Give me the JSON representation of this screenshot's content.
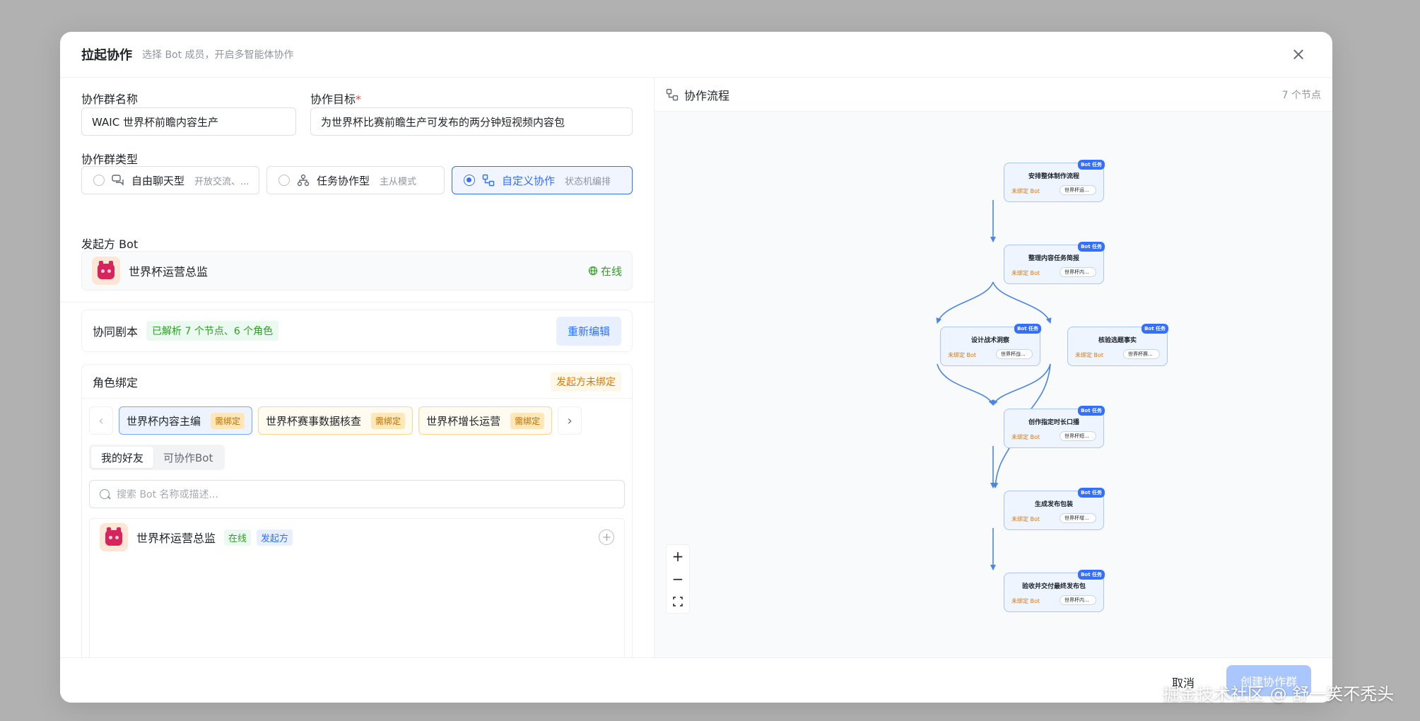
{
  "header": {
    "title": "拉起协作",
    "subtitle": "选择 Bot 成员，开启多智能体协作"
  },
  "form": {
    "group_name_label": "协作群名称",
    "group_name_value": "WAIC 世界杯前瞻内容生产",
    "goal_label": "协作目标",
    "goal_required_mark": "*",
    "goal_value": "为世界杯比赛前瞻生产可发布的两分钟短视频内容包",
    "type_label": "协作群类型",
    "types": [
      {
        "label": "自由聊天型",
        "sub": "开放交流、...",
        "icon": "chat-icon",
        "selected": false
      },
      {
        "label": "任务协作型",
        "sub": "主从模式",
        "icon": "hierarchy-icon",
        "selected": false
      },
      {
        "label": "自定义协作",
        "sub": "状态机编排",
        "icon": "flow-icon",
        "selected": true
      }
    ],
    "initiator_label": "发起方 Bot",
    "initiator_name": "世界杯运营总监",
    "initiator_status": "在线"
  },
  "script": {
    "label": "协同剧本",
    "parsed_tag": "已解析 7 个节点、6 个角色",
    "reedit_label": "重新编辑"
  },
  "roles": {
    "label": "角色绑定",
    "warning_tag": "发起方未绑定",
    "chips": [
      {
        "name": "世界杯内容主编",
        "tag": "需绑定"
      },
      {
        "name": "世界杯赛事数据核查",
        "tag": "需绑定"
      },
      {
        "name": "世界杯增长运营",
        "tag": "需绑定"
      }
    ],
    "tabs": [
      "我的好友",
      "可协作Bot"
    ],
    "search_placeholder": "搜索 Bot 名称或描述...",
    "list": [
      {
        "name": "世界杯运营总监",
        "status": "在线",
        "role": "发起方"
      }
    ]
  },
  "flow": {
    "title": "协作流程",
    "node_count": "7 个节点",
    "badge": "Bot 任务",
    "unbound_label": "未绑定 Bot",
    "nodes": [
      {
        "title": "安排整体制作流程",
        "pill": "世界杯运..."
      },
      {
        "title": "整理内容任务简报",
        "pill": "世界杯内..."
      },
      {
        "title": "设计战术洞察",
        "pill": "世界杯战..."
      },
      {
        "title": "核验选题事实",
        "pill": "世界杯赛..."
      },
      {
        "title": "创作指定时长口播",
        "pill": "世界杯短..."
      },
      {
        "title": "生成发布包装",
        "pill": "世界杯增..."
      },
      {
        "title": "验收并交付最终发布包",
        "pill": "世界杯内..."
      }
    ]
  },
  "footer": {
    "cancel_label": "取消",
    "create_label": "创建协作群"
  },
  "watermark": "掘金技术社区 @ 舒一笑不秃头"
}
